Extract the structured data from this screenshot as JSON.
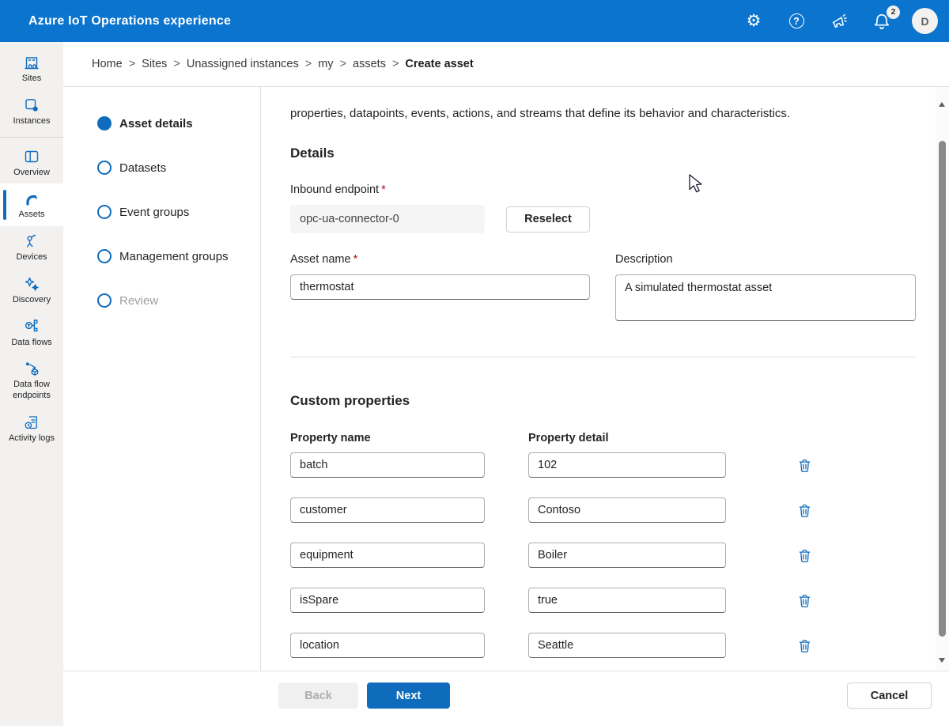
{
  "header": {
    "title": "Azure IoT Operations experience",
    "gear_glyph": "⚙",
    "help_glyph": "?",
    "notification_badge": "2",
    "avatar_initial": "D"
  },
  "breadcrumb": {
    "separator": ">",
    "items": [
      "Home",
      "Sites",
      "Unassigned instances",
      "my",
      "assets"
    ],
    "current": "Create asset"
  },
  "sidebar": {
    "items": [
      {
        "label": "Sites",
        "icon": "sites-icon"
      },
      {
        "label": "Instances",
        "icon": "instances-icon"
      },
      {
        "label": "Overview",
        "icon": "overview-icon"
      },
      {
        "label": "Assets",
        "icon": "assets-icon",
        "selected": true
      },
      {
        "label": "Devices",
        "icon": "devices-icon"
      },
      {
        "label": "Discovery",
        "icon": "discovery-icon"
      },
      {
        "label": "Data flows",
        "icon": "data-flows-icon"
      },
      {
        "label": "Data flow endpoints",
        "icon": "data-flow-endpoints-icon"
      },
      {
        "label": "Activity logs",
        "icon": "activity-logs-icon"
      }
    ]
  },
  "wizard": {
    "steps": [
      {
        "label": "Asset details",
        "state": "active"
      },
      {
        "label": "Datasets",
        "state": "upcoming"
      },
      {
        "label": "Event groups",
        "state": "upcoming"
      },
      {
        "label": "Management groups",
        "state": "upcoming"
      },
      {
        "label": "Review",
        "state": "disabled"
      }
    ]
  },
  "form": {
    "intro_text": "properties, datapoints, events, actions, and streams that define its behavior and characteristics.",
    "details_heading": "Details",
    "required_mark": "*",
    "inbound_endpoint": {
      "label": "Inbound endpoint",
      "value": "opc-ua-connector-0",
      "reselect_label": "Reselect"
    },
    "asset_name": {
      "label": "Asset name",
      "value": "thermostat"
    },
    "description": {
      "label": "Description",
      "value": "A simulated thermostat asset"
    }
  },
  "custom_properties": {
    "heading": "Custom properties",
    "name_header": "Property name",
    "detail_header": "Property detail",
    "rows": [
      {
        "name": "batch",
        "detail": "102"
      },
      {
        "name": "customer",
        "detail": "Contoso"
      },
      {
        "name": "equipment",
        "detail": "Boiler"
      },
      {
        "name": "isSpare",
        "detail": "true"
      },
      {
        "name": "location",
        "detail": "Seattle"
      }
    ]
  },
  "footer": {
    "back_label": "Back",
    "next_label": "Next",
    "cancel_label": "Cancel"
  },
  "colors": {
    "topbar": "#0b74ce",
    "accent": "#0f6cbd",
    "sidebar_bg": "#f2f1f0",
    "divider": "#e0e0e0",
    "required": "#b10e1c",
    "disabled_text": "#aeaeae"
  }
}
